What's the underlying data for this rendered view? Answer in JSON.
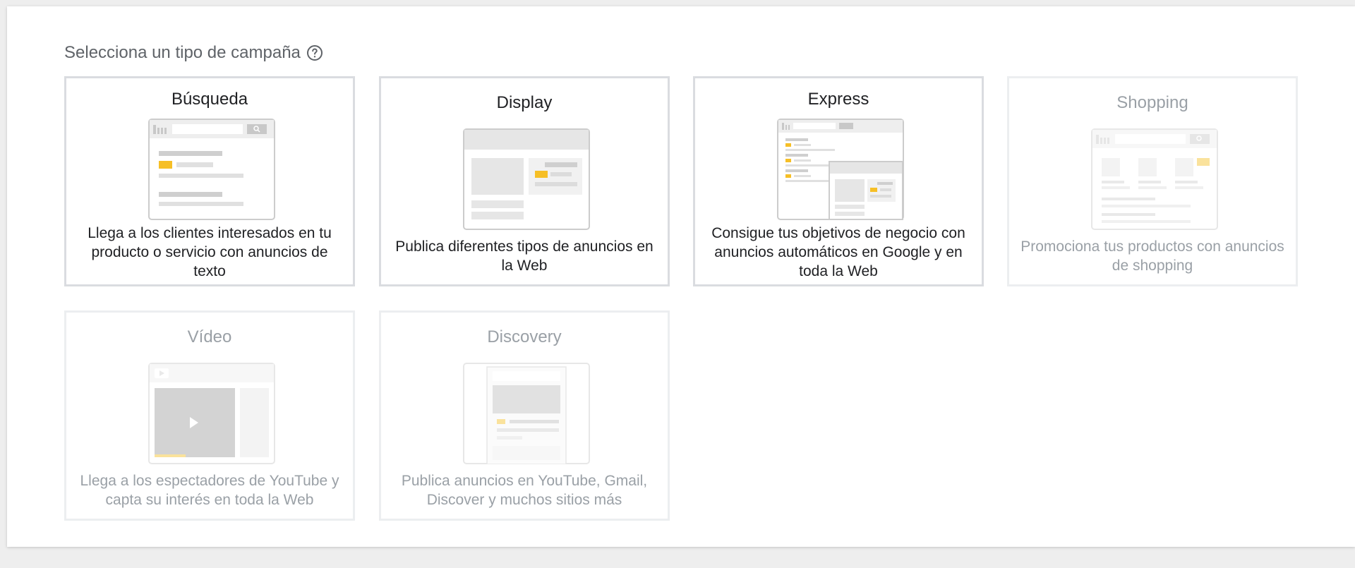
{
  "heading": {
    "text": "Selecciona un tipo de campaña",
    "help_icon": "help-circle-icon"
  },
  "colors": {
    "accent_yellow": "#f6bf26",
    "border": "#dadce0",
    "text": "#202124",
    "muted_text": "#9aa0a6"
  },
  "campaign_types": [
    {
      "title": "Búsqueda",
      "description": "Llega a los clientes interesados en tu producto o servicio con anuncios de texto",
      "enabled": true
    },
    {
      "title": "Display",
      "description": "Publica diferentes tipos de anuncios en la Web",
      "enabled": true
    },
    {
      "title": "Express",
      "description": "Consigue tus objetivos de negocio con anuncios automáticos en Google y en toda la Web",
      "enabled": true
    },
    {
      "title": "Shopping",
      "description": "Promociona tus productos con anuncios de shopping",
      "enabled": false
    },
    {
      "title": "Vídeo",
      "description": "Llega a los espectadores de YouTube y capta su interés en toda la Web",
      "enabled": false
    },
    {
      "title": "Discovery",
      "description": "Publica anuncios en YouTube, Gmail, Discover y muchos sitios más",
      "enabled": false
    }
  ]
}
